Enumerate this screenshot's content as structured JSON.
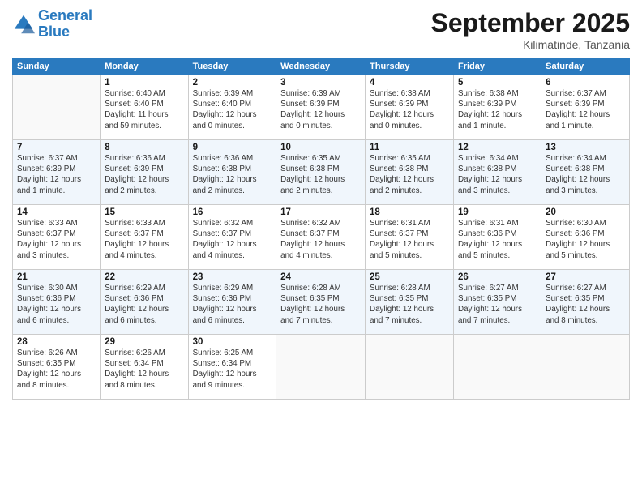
{
  "header": {
    "logo_line1": "General",
    "logo_line2": "Blue",
    "month_title": "September 2025",
    "subtitle": "Kilimatinde, Tanzania"
  },
  "weekdays": [
    "Sunday",
    "Monday",
    "Tuesday",
    "Wednesday",
    "Thursday",
    "Friday",
    "Saturday"
  ],
  "weeks": [
    [
      {
        "day": "",
        "info": ""
      },
      {
        "day": "1",
        "info": "Sunrise: 6:40 AM\nSunset: 6:40 PM\nDaylight: 11 hours\nand 59 minutes."
      },
      {
        "day": "2",
        "info": "Sunrise: 6:39 AM\nSunset: 6:40 PM\nDaylight: 12 hours\nand 0 minutes."
      },
      {
        "day": "3",
        "info": "Sunrise: 6:39 AM\nSunset: 6:39 PM\nDaylight: 12 hours\nand 0 minutes."
      },
      {
        "day": "4",
        "info": "Sunrise: 6:38 AM\nSunset: 6:39 PM\nDaylight: 12 hours\nand 0 minutes."
      },
      {
        "day": "5",
        "info": "Sunrise: 6:38 AM\nSunset: 6:39 PM\nDaylight: 12 hours\nand 1 minute."
      },
      {
        "day": "6",
        "info": "Sunrise: 6:37 AM\nSunset: 6:39 PM\nDaylight: 12 hours\nand 1 minute."
      }
    ],
    [
      {
        "day": "7",
        "info": "Sunrise: 6:37 AM\nSunset: 6:39 PM\nDaylight: 12 hours\nand 1 minute."
      },
      {
        "day": "8",
        "info": "Sunrise: 6:36 AM\nSunset: 6:39 PM\nDaylight: 12 hours\nand 2 minutes."
      },
      {
        "day": "9",
        "info": "Sunrise: 6:36 AM\nSunset: 6:38 PM\nDaylight: 12 hours\nand 2 minutes."
      },
      {
        "day": "10",
        "info": "Sunrise: 6:35 AM\nSunset: 6:38 PM\nDaylight: 12 hours\nand 2 minutes."
      },
      {
        "day": "11",
        "info": "Sunrise: 6:35 AM\nSunset: 6:38 PM\nDaylight: 12 hours\nand 2 minutes."
      },
      {
        "day": "12",
        "info": "Sunrise: 6:34 AM\nSunset: 6:38 PM\nDaylight: 12 hours\nand 3 minutes."
      },
      {
        "day": "13",
        "info": "Sunrise: 6:34 AM\nSunset: 6:38 PM\nDaylight: 12 hours\nand 3 minutes."
      }
    ],
    [
      {
        "day": "14",
        "info": "Sunrise: 6:33 AM\nSunset: 6:37 PM\nDaylight: 12 hours\nand 3 minutes."
      },
      {
        "day": "15",
        "info": "Sunrise: 6:33 AM\nSunset: 6:37 PM\nDaylight: 12 hours\nand 4 minutes."
      },
      {
        "day": "16",
        "info": "Sunrise: 6:32 AM\nSunset: 6:37 PM\nDaylight: 12 hours\nand 4 minutes."
      },
      {
        "day": "17",
        "info": "Sunrise: 6:32 AM\nSunset: 6:37 PM\nDaylight: 12 hours\nand 4 minutes."
      },
      {
        "day": "18",
        "info": "Sunrise: 6:31 AM\nSunset: 6:37 PM\nDaylight: 12 hours\nand 5 minutes."
      },
      {
        "day": "19",
        "info": "Sunrise: 6:31 AM\nSunset: 6:36 PM\nDaylight: 12 hours\nand 5 minutes."
      },
      {
        "day": "20",
        "info": "Sunrise: 6:30 AM\nSunset: 6:36 PM\nDaylight: 12 hours\nand 5 minutes."
      }
    ],
    [
      {
        "day": "21",
        "info": "Sunrise: 6:30 AM\nSunset: 6:36 PM\nDaylight: 12 hours\nand 6 minutes."
      },
      {
        "day": "22",
        "info": "Sunrise: 6:29 AM\nSunset: 6:36 PM\nDaylight: 12 hours\nand 6 minutes."
      },
      {
        "day": "23",
        "info": "Sunrise: 6:29 AM\nSunset: 6:36 PM\nDaylight: 12 hours\nand 6 minutes."
      },
      {
        "day": "24",
        "info": "Sunrise: 6:28 AM\nSunset: 6:35 PM\nDaylight: 12 hours\nand 7 minutes."
      },
      {
        "day": "25",
        "info": "Sunrise: 6:28 AM\nSunset: 6:35 PM\nDaylight: 12 hours\nand 7 minutes."
      },
      {
        "day": "26",
        "info": "Sunrise: 6:27 AM\nSunset: 6:35 PM\nDaylight: 12 hours\nand 7 minutes."
      },
      {
        "day": "27",
        "info": "Sunrise: 6:27 AM\nSunset: 6:35 PM\nDaylight: 12 hours\nand 8 minutes."
      }
    ],
    [
      {
        "day": "28",
        "info": "Sunrise: 6:26 AM\nSunset: 6:35 PM\nDaylight: 12 hours\nand 8 minutes."
      },
      {
        "day": "29",
        "info": "Sunrise: 6:26 AM\nSunset: 6:34 PM\nDaylight: 12 hours\nand 8 minutes."
      },
      {
        "day": "30",
        "info": "Sunrise: 6:25 AM\nSunset: 6:34 PM\nDaylight: 12 hours\nand 9 minutes."
      },
      {
        "day": "",
        "info": ""
      },
      {
        "day": "",
        "info": ""
      },
      {
        "day": "",
        "info": ""
      },
      {
        "day": "",
        "info": ""
      }
    ]
  ]
}
